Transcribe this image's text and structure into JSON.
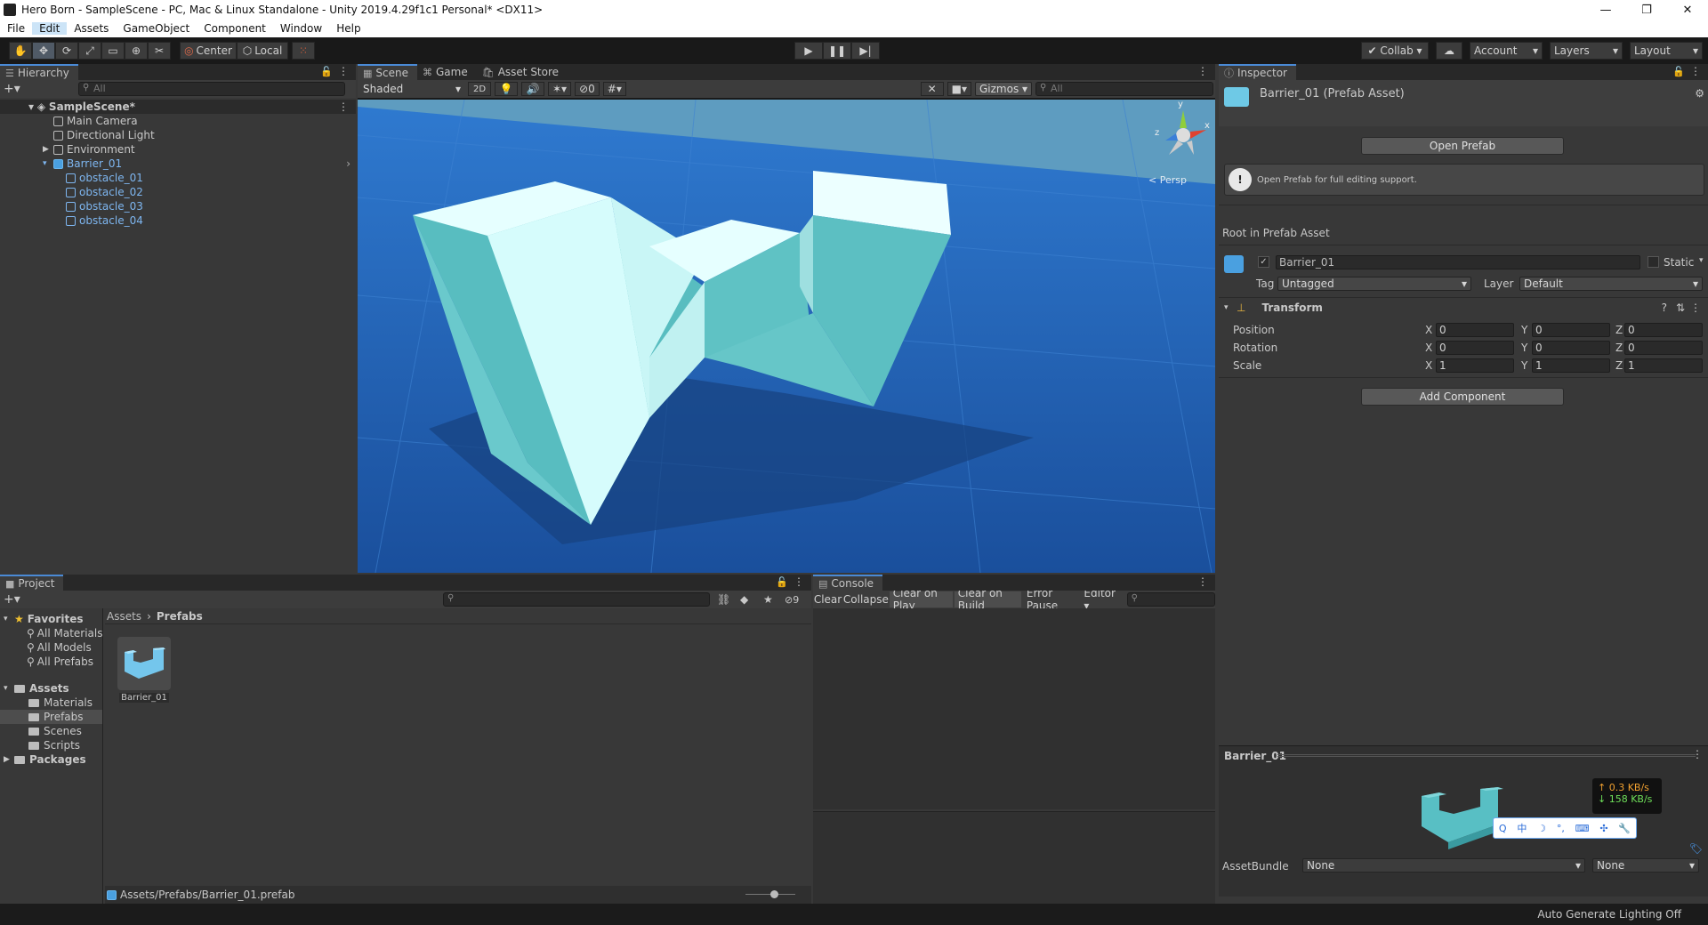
{
  "window": {
    "title": "Hero Born - SampleScene - PC, Mac & Linux Standalone - Unity 2019.4.29f1c1 Personal* <DX11>"
  },
  "menu": [
    "File",
    "Edit",
    "Assets",
    "GameObject",
    "Component",
    "Window",
    "Help"
  ],
  "toolbar": {
    "pivot": "Center",
    "space": "Local",
    "collab": "Collab ▾",
    "account": "Account",
    "layers": "Layers",
    "layout": "Layout"
  },
  "hierarchy": {
    "tab": "Hierarchy",
    "search_placeholder": "All",
    "scene": "SampleScene*",
    "items": [
      "Main Camera",
      "Directional Light",
      "Environment",
      "Barrier_01"
    ],
    "children": [
      "obstacle_01",
      "obstacle_02",
      "obstacle_03",
      "obstacle_04"
    ]
  },
  "scene": {
    "tabs": [
      "Scene",
      "Game",
      "Asset Store"
    ],
    "shading": "Shaded",
    "mode2d": "2D",
    "hidden_count": "0",
    "gizmos": "Gizmos",
    "search_placeholder": "All",
    "persp": "< Persp",
    "axis_y": "y",
    "axis_x": "x",
    "axis_z": "z"
  },
  "inspector": {
    "tab": "Inspector",
    "asset_title": "Barrier_01 (Prefab Asset)",
    "open_prefab": "Open Prefab",
    "info": "Open Prefab for full editing support.",
    "root_label": "Root in Prefab Asset",
    "object_name": "Barrier_01",
    "static": "Static",
    "tag_label": "Tag",
    "tag_value": "Untagged",
    "layer_label": "Layer",
    "layer_value": "Default",
    "transform": "Transform",
    "position_label": "Position",
    "rotation_label": "Rotation",
    "scale_label": "Scale",
    "position": {
      "x": "0",
      "y": "0",
      "z": "0"
    },
    "rotation": {
      "x": "0",
      "y": "0",
      "z": "0"
    },
    "scale": {
      "x": "1",
      "y": "1",
      "z": "1"
    },
    "x": "X",
    "y": "Y",
    "z": "Z",
    "add_component": "Add Component",
    "preview_title": "Barrier_01",
    "upload": "↑ 0.3 KB/s",
    "download": "↓ 158 KB/s",
    "ime": [
      "Q",
      "中",
      "☽",
      "°,",
      "⌨",
      "✣",
      "🔧"
    ],
    "assetbundle_label": "AssetBundle",
    "assetbundle_value": "None",
    "assetbundle_variant": "None"
  },
  "project": {
    "tab": "Project",
    "breadcrumb_root": "Assets",
    "breadcrumb_current": "Prefabs",
    "hidden_count": "9",
    "favorites_label": "Favorites",
    "favorites": [
      "All Materials",
      "All Models",
      "All Prefabs"
    ],
    "assets_label": "Assets",
    "folders": [
      "Materials",
      "Prefabs",
      "Scenes",
      "Scripts"
    ],
    "packages_label": "Packages",
    "asset_item": "Barrier_01",
    "footer_path": "Assets/Prefabs/Barrier_01.prefab"
  },
  "console": {
    "tab": "Console",
    "buttons": [
      "Clear",
      "Collapse",
      "Clear on Play",
      "Clear on Build",
      "Error Pause",
      "Editor ▾"
    ]
  },
  "status": {
    "text": "Auto Generate Lighting Off"
  },
  "colors": {
    "accent": "#4a8ad6",
    "selection": "#2c5d87",
    "sky": "#5e9cc0",
    "ground": "#1f5ba8",
    "barrier": "#d8fbfb"
  }
}
